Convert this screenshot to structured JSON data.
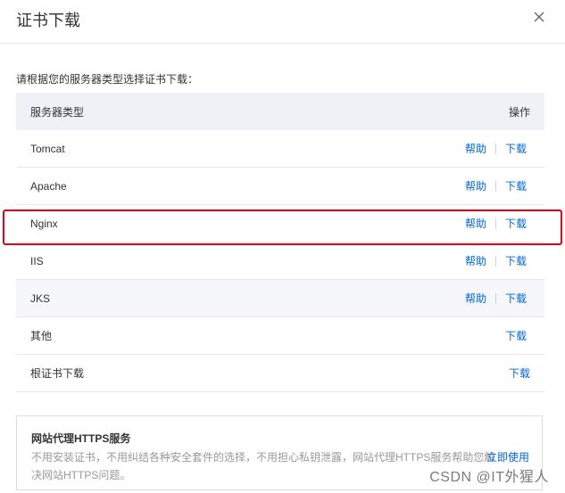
{
  "dialog": {
    "title": "证书下载",
    "hint": "请根据您的服务器类型选择证书下载：",
    "table": {
      "col_server": "服务器类型",
      "col_action": "操作",
      "rows": [
        {
          "name": "Tomcat",
          "help": "帮助",
          "download": "下载"
        },
        {
          "name": "Apache",
          "help": "帮助",
          "download": "下载"
        },
        {
          "name": "Nginx",
          "help": "帮助",
          "download": "下载"
        },
        {
          "name": "IIS",
          "help": "帮助",
          "download": "下载"
        },
        {
          "name": "JKS",
          "help": "帮助",
          "download": "下载"
        },
        {
          "name": "其他",
          "download": "下载"
        },
        {
          "name": "根证书下载",
          "download": "下载"
        }
      ]
    },
    "promo": {
      "title": "网站代理HTTPS服务",
      "text": "不用安装证书，不用纠结各种安全套件的选择，不用担心私钥泄露，网站代理HTTPS服务帮助您解决网站HTTPS问题。",
      "link": "立即使用"
    }
  },
  "watermark": "CSDN @IT外猩人",
  "colors": {
    "accent": "#0068d9",
    "highlight_border": "#e60012",
    "header_bg": "#eef1f6"
  }
}
